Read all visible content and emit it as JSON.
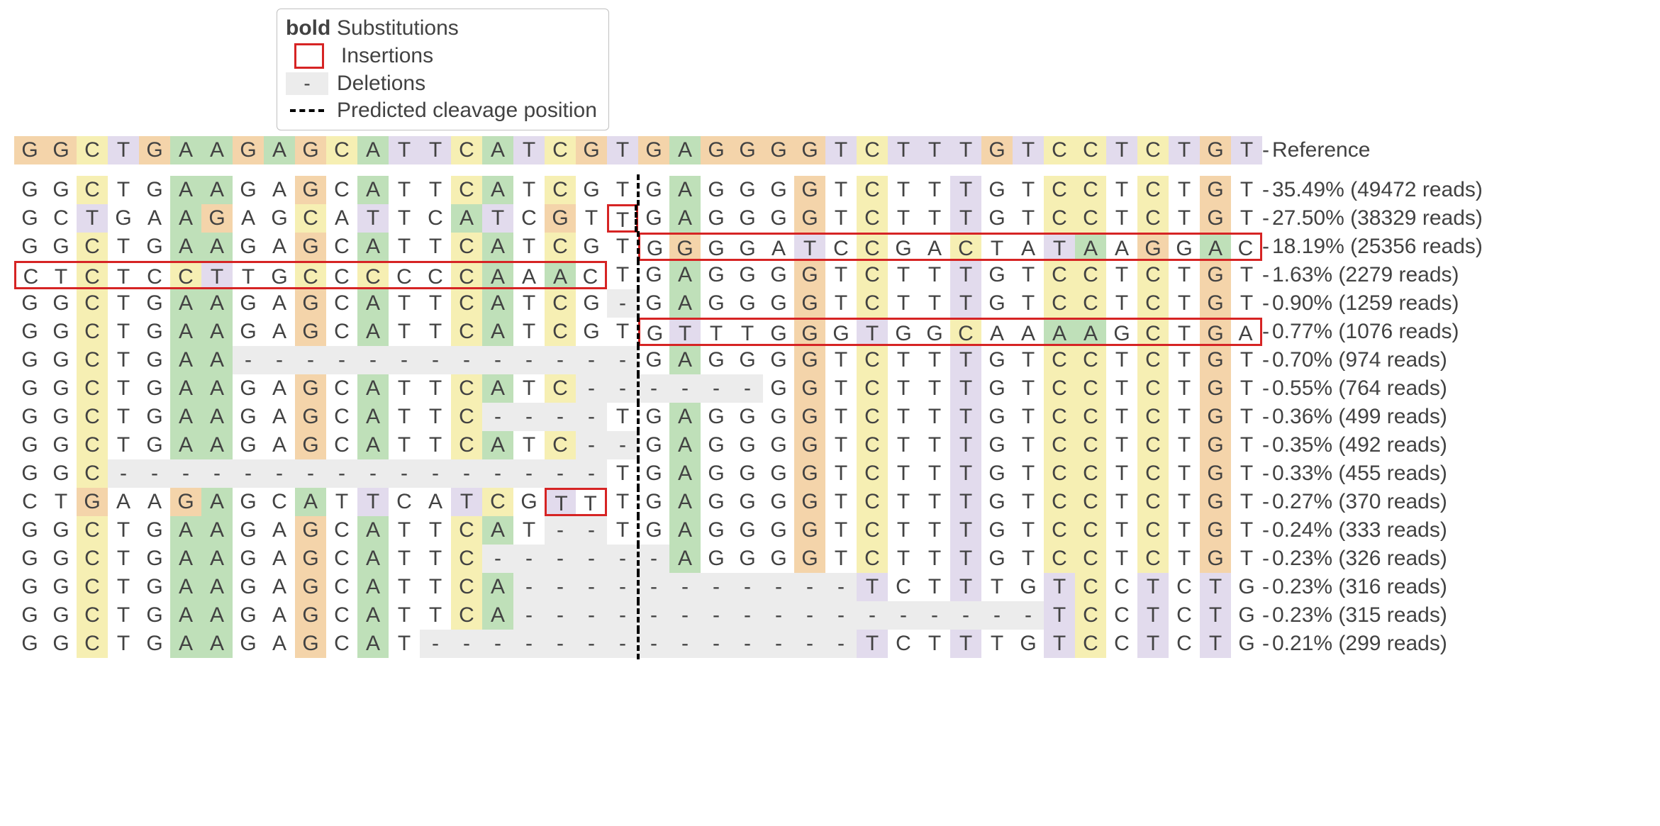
{
  "legend": {
    "subs": "Substitutions",
    "ins": "Insertions",
    "del": "Deletions",
    "cleave": "Predicted cleavage position",
    "bold_key": "bold",
    "del_key": "-",
    "dash_key": ""
  },
  "colors": {
    "A": "#bfe0b9",
    "C": "#f6efb3",
    "G": "#f4d4aa",
    "T": "#e2dbed",
    "del": "#ececec",
    "ins_border": "#d62424"
  },
  "reference_label": "Reference",
  "reference": "GGCTGAAGAGCATTCATCGTGAGGGGTCTTTGTCCTCTGT",
  "cleavage_after_index": 19,
  "ref_highlight": {
    "mode": "all"
  },
  "highlight_cols": [
    2,
    5,
    6,
    9,
    11,
    14,
    15,
    17,
    21,
    25,
    27,
    30,
    33,
    34,
    36,
    38
  ],
  "chart_data": {
    "type": "table",
    "title": "Allele alignment around predicted cleavage site",
    "columns": [
      "sequence",
      "insertion_span",
      "percent",
      "reads"
    ],
    "rows": [
      {
        "sequence": "GGCTGAAGAGCATTCATCGTGAGGGGTCTTTGTCCTCTGT",
        "insertion_span": null,
        "percent": 35.49,
        "reads": 49472
      },
      {
        "sequence": "GCTGAAGAGCATTCATCGTTGAGGGGTCTTTGTCCTCTGT",
        "insertion_span": [
          19,
          19
        ],
        "percent": 27.5,
        "reads": 38329
      },
      {
        "sequence": "GGCTGAAGAGCATTCATCGTGGGGATCCGACTATAAGGAC",
        "insertion_span": [
          20,
          39
        ],
        "percent": 18.19,
        "reads": 25356
      },
      {
        "sequence": "CTCTCCTTGCCCCCCAAACTGAGGGGTCTTTGTCCTCTGT",
        "insertion_span": [
          0,
          18
        ],
        "percent": 1.63,
        "reads": 2279
      },
      {
        "sequence": "GGCTGAAGAGCATTCATCG-GAGGGGTCTTTGTCCTCTGT",
        "insertion_span": null,
        "percent": 0.9,
        "reads": 1259
      },
      {
        "sequence": "GGCTGAAGAGCATTCATCGTGTTTGGGTGGCAAAAGCTGA",
        "insertion_span": [
          20,
          39
        ],
        "percent": 0.77,
        "reads": 1076
      },
      {
        "sequence": "GGCTGAA-------------GAGGGGTCTTTGTCCTCTGT",
        "insertion_span": null,
        "percent": 0.7,
        "reads": 974
      },
      {
        "sequence": "GGCTGAAGAGCATTCATC------GGTCTTTGTCCTCTGT",
        "insertion_span": null,
        "percent": 0.55,
        "reads": 764
      },
      {
        "sequence": "GGCTGAAGAGCATTC----TGAGGGGTCTTTGTCCTCTGT",
        "insertion_span": null,
        "percent": 0.36,
        "reads": 499
      },
      {
        "sequence": "GGCTGAAGAGCATTCATC--GAGGGGTCTTTGTCCTCTGT",
        "insertion_span": null,
        "percent": 0.35,
        "reads": 492
      },
      {
        "sequence": "GGC----------------TGAGGGGTCTTTGTCCTCTGT",
        "insertion_span": null,
        "percent": 0.33,
        "reads": 455
      },
      {
        "sequence": "CTGAAGAGCATTCATCGTTTGAGGGGTCTTTGTCCTCTGT",
        "insertion_span": [
          17,
          18
        ],
        "percent": 0.27,
        "reads": 370
      },
      {
        "sequence": "GGCTGAAGAGCATTCAT--TGAGGGGTCTTTGTCCTCTGT",
        "insertion_span": null,
        "percent": 0.24,
        "reads": 333
      },
      {
        "sequence": "GGCTGAAGAGCATTC------AGGGGTCTTTGTCCTCTGT",
        "insertion_span": null,
        "percent": 0.23,
        "reads": 326
      },
      {
        "sequence": "GGCTGAAGAGCATTCA-----------TCTTTGTCCTCTGT",
        "insertion_span": null,
        "percent": 0.23,
        "reads": 316
      },
      {
        "sequence": "GGCTGAAGAGCATTCA-----------------TCCTCTGT",
        "insertion_span": null,
        "percent": 0.23,
        "reads": 315
      },
      {
        "sequence": "GGCTGAAGAGCAT--------------TCTTTGTCCTCTGT",
        "insertion_span": null,
        "percent": 0.21,
        "reads": 299
      }
    ]
  }
}
